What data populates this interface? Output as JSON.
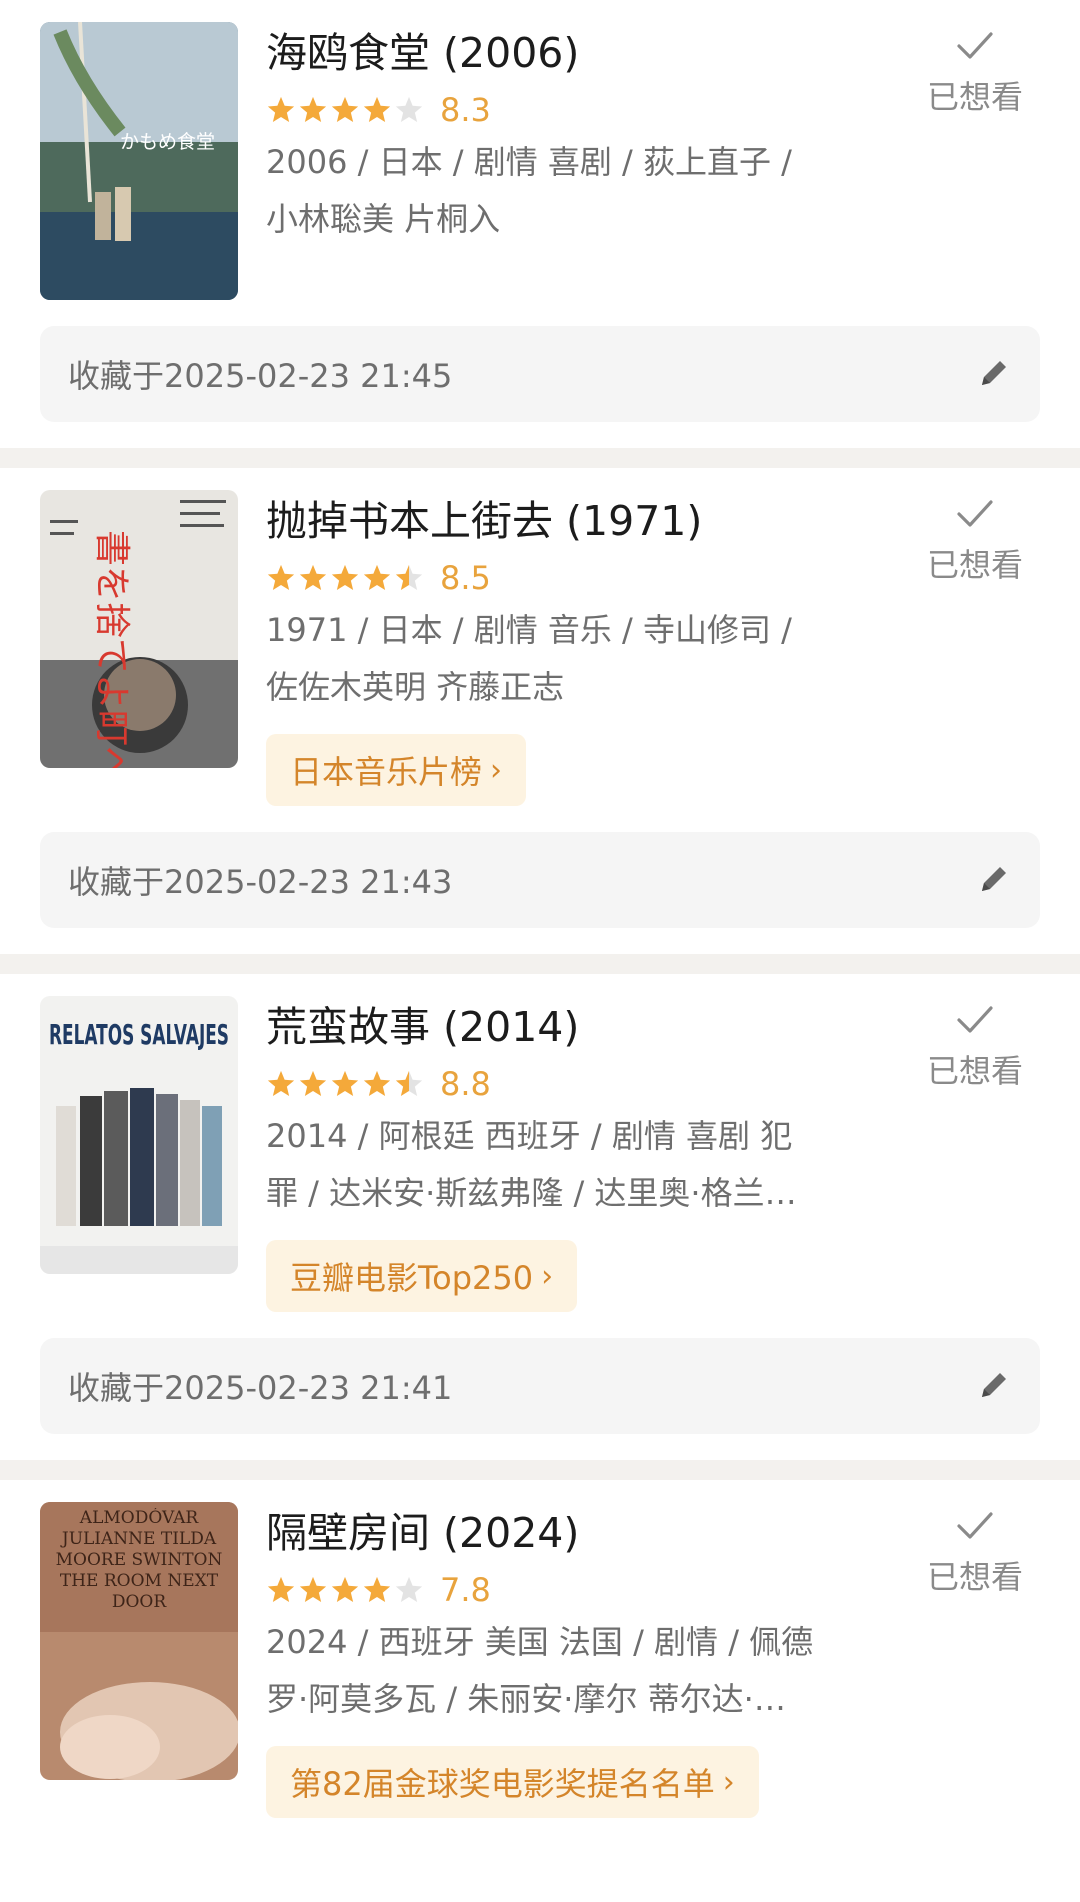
{
  "items": [
    {
      "title": "海鸥食堂 (2006)",
      "rating": 4,
      "score": "8.3",
      "meta_line1": "2006 / 日本 / 剧情 喜剧 / 荻上直子 /",
      "meta_line2": "小林聡美 片桐入",
      "tag": "",
      "status": "已想看",
      "collected": "收藏于2025-02-23 21:45",
      "poster_text": "かもめ食堂"
    },
    {
      "title": "抛掉书本上街去 (1971)",
      "rating": 4.5,
      "score": "8.5",
      "meta_line1": "1971 / 日本 / 剧情 音乐 / 寺山修司 /",
      "meta_line2": "佐佐木英明 齐藤正志",
      "tag": "日本音乐片榜",
      "status": "已想看",
      "collected": "收藏于2025-02-23 21:43",
      "poster_text": "書を捨てよ町へ出よう"
    },
    {
      "title": "荒蛮故事 (2014)",
      "rating": 4.5,
      "score": "8.8",
      "meta_line1": "2014 / 阿根廷 西班牙 / 剧情 喜剧 犯",
      "meta_line2": "罪 / 达米安·斯兹弗隆 / 达里奥·格兰…",
      "tag": "豆瓣电影Top250",
      "status": "已想看",
      "collected": "收藏于2025-02-23 21:41",
      "poster_text": "RELATOS SALVAJES"
    },
    {
      "title": "隔壁房间 (2024)",
      "rating": 4,
      "score": "7.8",
      "meta_line1": "2024 / 西班牙 美国 法国 / 剧情 / 佩德",
      "meta_line2": "罗·阿莫多瓦 / 朱丽安·摩尔 蒂尔达·…",
      "tag": "第82届金球奖电影奖提名名单",
      "status": "已想看",
      "collected": "",
      "poster_text": "ALMODÓVAR JULIANNE TILDA MOORE SWINTON THE ROOM NEXT DOOR"
    }
  ],
  "colors": {
    "star": "#f4a93a",
    "star_empty": "#e3e3e3",
    "score": "#e8a33d",
    "tag_bg": "#fdf3e1",
    "tag_text": "#d4852a",
    "separator": "#f3f1ee",
    "collect_bg": "#f5f5f5"
  },
  "icons": {
    "check": "check-icon",
    "edit": "edit-pencil-icon",
    "chevron": "chevron-right-icon",
    "star": "star-icon"
  }
}
